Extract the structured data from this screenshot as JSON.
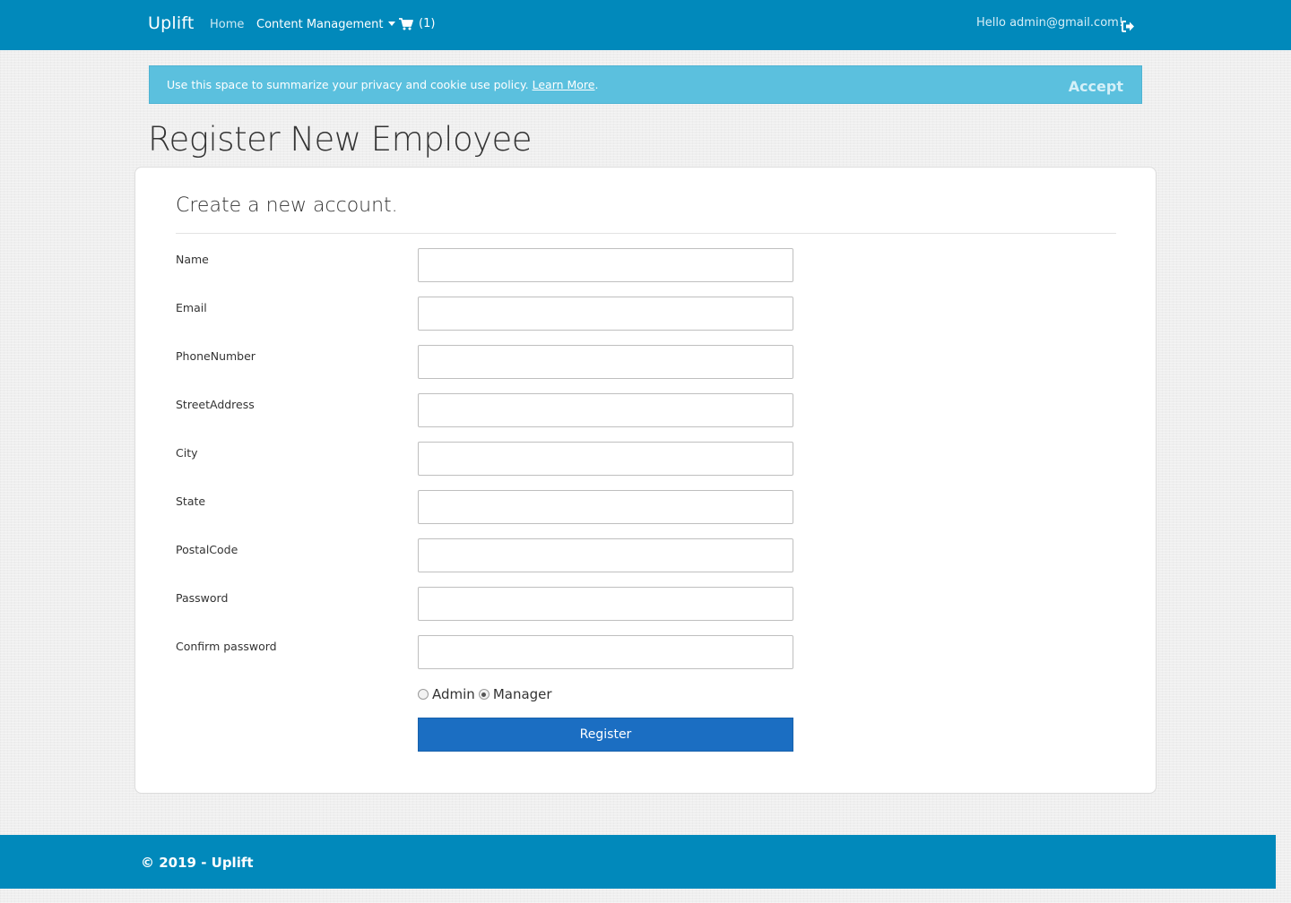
{
  "navbar": {
    "brand": "Uplift",
    "home": "Home",
    "content_management": "Content Management",
    "cart_count": "(1)",
    "greeting": "Hello admin@gmail.com!"
  },
  "cookie": {
    "text": "Use this space to summarize your privacy and cookie use policy.",
    "learn_more": "Learn More",
    "period": ".",
    "accept": "Accept"
  },
  "page": {
    "title": "Register New Employee",
    "subtitle": "Create a new account."
  },
  "form": {
    "fields": [
      {
        "label": "Name",
        "value": ""
      },
      {
        "label": "Email",
        "value": ""
      },
      {
        "label": "PhoneNumber",
        "value": ""
      },
      {
        "label": "StreetAddress",
        "value": ""
      },
      {
        "label": "City",
        "value": ""
      },
      {
        "label": "State",
        "value": ""
      },
      {
        "label": "PostalCode",
        "value": ""
      },
      {
        "label": "Password",
        "value": ""
      },
      {
        "label": "Confirm password",
        "value": ""
      }
    ],
    "roles": [
      {
        "label": "Admin",
        "checked": false
      },
      {
        "label": "Manager",
        "checked": true
      }
    ],
    "submit": "Register"
  },
  "footer": {
    "text": "© 2019 - Uplift"
  },
  "colors": {
    "navbar": "#0189bb",
    "cookie_banner": "#5bc0de",
    "register_button": "#1b6ec2"
  },
  "icons": {
    "cart": "cart-icon",
    "logout": "sign-out-icon",
    "dropdown": "caret-down-icon"
  }
}
